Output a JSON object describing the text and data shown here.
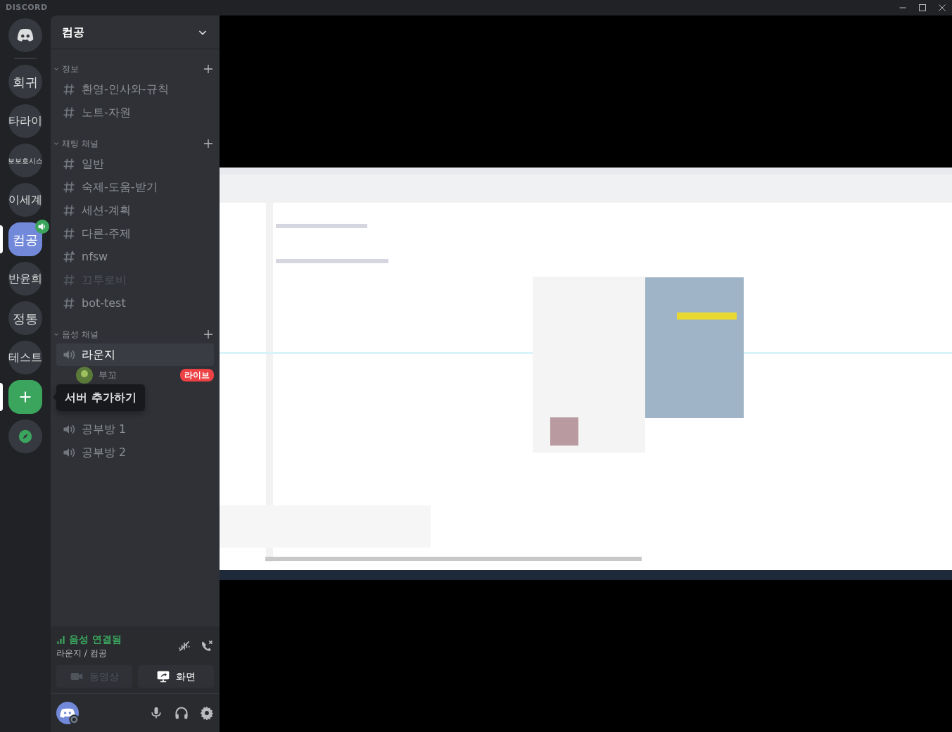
{
  "app": {
    "title": "DISCORD"
  },
  "servers": [
    {
      "label": "회귀",
      "selected": false,
      "voice_active": false
    },
    {
      "label": "타라이",
      "selected": false,
      "voice_active": false
    },
    {
      "label": "보보호시스",
      "selected": false,
      "voice_active": false
    },
    {
      "label": "이세계",
      "selected": false,
      "voice_active": false
    },
    {
      "label": "컴공",
      "selected": true,
      "voice_active": true
    },
    {
      "label": "반윤희",
      "selected": false,
      "voice_active": false
    },
    {
      "label": "정통",
      "selected": false,
      "voice_active": false
    },
    {
      "label": "테스트",
      "selected": false,
      "voice_active": false
    }
  ],
  "add_server": {
    "tooltip": "서버 추가하기"
  },
  "server_header": {
    "name": "컴공"
  },
  "categories": [
    {
      "name": "정보",
      "channels": [
        {
          "kind": "text",
          "name": "환영-인사와-규칙",
          "selected": false,
          "muted": false
        },
        {
          "kind": "text",
          "name": "노트-자원",
          "selected": false,
          "muted": false
        }
      ]
    },
    {
      "name": "채팅 채널",
      "channels": [
        {
          "kind": "text",
          "name": "일반",
          "selected": false,
          "muted": false
        },
        {
          "kind": "text",
          "name": "숙제-도움-받기",
          "selected": false,
          "muted": false
        },
        {
          "kind": "text",
          "name": "세션-계획",
          "selected": false,
          "muted": false
        },
        {
          "kind": "text",
          "name": "다른-주제",
          "selected": false,
          "muted": false
        },
        {
          "kind": "restricted",
          "name": "nfsw",
          "selected": false,
          "muted": false
        },
        {
          "kind": "text",
          "name": "끄투로비",
          "selected": false,
          "muted": true
        },
        {
          "kind": "text",
          "name": "bot-test",
          "selected": false,
          "muted": false
        }
      ]
    },
    {
      "name": "음성 채널",
      "channels": [
        {
          "kind": "voice",
          "name": "라운지",
          "selected": true,
          "muted": false,
          "users": [
            {
              "name": "부꼬",
              "badge": "라이브"
            }
          ]
        },
        {
          "kind": "voice",
          "name": "공부방 1",
          "selected": false,
          "muted": false
        },
        {
          "kind": "voice",
          "name": "공부방 2",
          "selected": false,
          "muted": false
        }
      ]
    }
  ],
  "voice_status": {
    "status": "음성 연결됨",
    "location": "라운지 / 컴공"
  },
  "media_buttons": [
    {
      "kind": "video",
      "label": "동영상",
      "disabled": true
    },
    {
      "kind": "screen",
      "label": "화면",
      "disabled": false
    }
  ]
}
